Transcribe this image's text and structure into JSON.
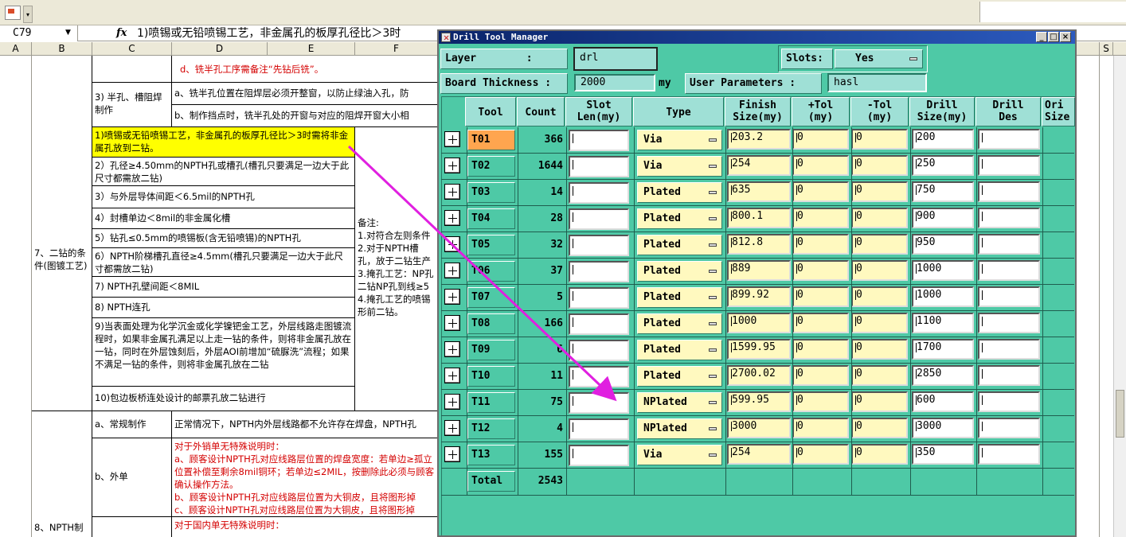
{
  "excel": {
    "name_box": "C79",
    "fx_label": "fx",
    "formula": "1)喷锡或无铅喷锡工艺，非金属孔的板厚孔径比＞3时",
    "columns": [
      "A",
      "B",
      "C",
      "D",
      "E",
      "F",
      "S"
    ],
    "cells": {
      "d_milling": "d、铣半孔工序需备注“先钻后铣”。",
      "half_slot_label": "3) 半孔、槽阻焊制作",
      "half_slot_a": "a、铣半孔位置在阻焊层必须开整窗，以防止绿油入孔，防",
      "half_slot_b": "b、制作挡点时，铣半孔处的开窗与对应的阻焊开窗大小相",
      "sec7_label": "7、二钻的条件(图镀工艺)",
      "cond1": "1)喷锡或无铅喷锡工艺，非金属孔的板厚孔径比＞3时需将非金属孔放到二钻。",
      "cond2": "2）孔径≥4.50mm的NPTH孔或槽孔(槽孔只要满足一边大于此尺寸都需放二钻)",
      "cond3": "3）与外层导体间距＜6.5mil的NPTH孔",
      "cond4": "4）封槽单边＜8mil的非金属化槽",
      "cond5": "5）钻孔≤0.5mm的喷锡板(含无铅喷锡)的NPTH孔",
      "cond6": "6）NPTH阶梯槽孔直径≥4.5mm(槽孔只要满足一边大于此尺寸都需放二钻)",
      "cond7": "7) NPTH孔壁间距＜8MIL",
      "cond8": "8) NPTH连孔",
      "cond9": "9)当表面处理为化学沉金或化学镍钯金工艺，外层线路走图镀流程时，如果非金属孔满足以上走一钻的条件，则将非金属孔放在一钻，同时在外层蚀刻后，外层AOI前增加“硫脲洗”流程；如果不满足一钻的条件，则将非金属孔放在二钻",
      "cond10": "10)包边板桥连处设计的邮票孔放二钻进行",
      "notes": "备注:\n1.对符合左则条件\n2.对于NPTH槽孔，放于二钻生产\n3.掩孔工艺：NP孔二钻NP孔到线≥5\n4.掩孔工艺的喷锡形前二钻。",
      "sec8_a_label": "a、常规制作",
      "sec8_a_text": "正常情况下，NPTH内外层线路都不允许存在焊盘，NPTH孔",
      "sec8_b_label": "b、外单",
      "sec8_b_text": "对于外销单无特殊说明时：\na、顾客设计NPTH孔对应线路层位置的焊盘宽度：若单边≥孤立位置补偿至剩余8mil铜环；若单边≤2MIL，按删除此必须与顾客确认操作方法。\nb、顾客设计NPTH孔对应线路层位置为大铜皮，且将图形掉\nc、顾客设计NPTH孔对应线路层位置为大铜皮，且将图形掉",
      "sec8_label": "8、NPTH制",
      "sec8_c_text": "对于国内单无特殊说明时："
    }
  },
  "dtm": {
    "title": "Drill Tool Manager",
    "layer_label": "Layer        :",
    "layer_value": "drl",
    "slots_label": "Slots:",
    "slots_value": "Yes",
    "board_thickness_label": "Board Thickness :",
    "board_thickness_value": "2000",
    "unit": "my",
    "user_params_label": "User Parameters :",
    "user_params_value": "hasl",
    "headers": {
      "tool": "Tool",
      "count": "Count",
      "slot_len": "Slot\nLen(my)",
      "type": "Type",
      "finish": "Finish\nSize(my)",
      "plus_tol": "+Tol\n(my)",
      "minus_tol": "-Tol\n(my)",
      "drill": "Drill\nSize(my)",
      "drill_des": "Drill\nDes",
      "ori": "Ori\nSize"
    },
    "rows": [
      {
        "tool": "T01",
        "count": "366",
        "type": "Via",
        "finish": "203.2",
        "plus_tol": "0",
        "minus_tol": "0",
        "drill": "200"
      },
      {
        "tool": "T02",
        "count": "1644",
        "type": "Via",
        "finish": "254",
        "plus_tol": "0",
        "minus_tol": "0",
        "drill": "250"
      },
      {
        "tool": "T03",
        "count": "14",
        "type": "Plated",
        "finish": "635",
        "plus_tol": "0",
        "minus_tol": "0",
        "drill": "750"
      },
      {
        "tool": "T04",
        "count": "28",
        "type": "Plated",
        "finish": "800.1",
        "plus_tol": "0",
        "minus_tol": "0",
        "drill": "900"
      },
      {
        "tool": "T05",
        "count": "32",
        "type": "Plated",
        "finish": "812.8",
        "plus_tol": "0",
        "minus_tol": "0",
        "drill": "950"
      },
      {
        "tool": "T06",
        "count": "37",
        "type": "Plated",
        "finish": "889",
        "plus_tol": "0",
        "minus_tol": "0",
        "drill": "1000"
      },
      {
        "tool": "T07",
        "count": "5",
        "type": "Plated",
        "finish": "899.92",
        "plus_tol": "0",
        "minus_tol": "0",
        "drill": "1000"
      },
      {
        "tool": "T08",
        "count": "166",
        "type": "Plated",
        "finish": "1000",
        "plus_tol": "0",
        "minus_tol": "0",
        "drill": "1100"
      },
      {
        "tool": "T09",
        "count": "6",
        "type": "Plated",
        "finish": "1599.95",
        "plus_tol": "0",
        "minus_tol": "0",
        "drill": "1700"
      },
      {
        "tool": "T10",
        "count": "11",
        "type": "Plated",
        "finish": "2700.02",
        "plus_tol": "0",
        "minus_tol": "0",
        "drill": "2850"
      },
      {
        "tool": "T11",
        "count": "75",
        "type": "NPlated",
        "finish": "599.95",
        "plus_tol": "0",
        "minus_tol": "0",
        "drill": "600"
      },
      {
        "tool": "T12",
        "count": "4",
        "type": "NPlated",
        "finish": "3000",
        "plus_tol": "0",
        "minus_tol": "0",
        "drill": "3000"
      },
      {
        "tool": "T13",
        "count": "155",
        "type": "Via",
        "finish": "254",
        "plus_tol": "0",
        "minus_tol": "0",
        "drill": "350"
      }
    ],
    "total_label": "Total",
    "total_value": "2543"
  },
  "colors": {
    "window_bg": "#4ec9a6",
    "label_bg": "#9fe0d6",
    "field_bg": "#fff9bf",
    "selected_tool": "#ffa54f",
    "arrow": "#e020e0",
    "highlight": "#ffff00"
  },
  "icons": {
    "expand_row": "plus-box-icon",
    "dropdown": "dropdown-icon",
    "window_close": "close-icon",
    "window_min": "minimize-icon",
    "window_max": "maximize-icon"
  }
}
